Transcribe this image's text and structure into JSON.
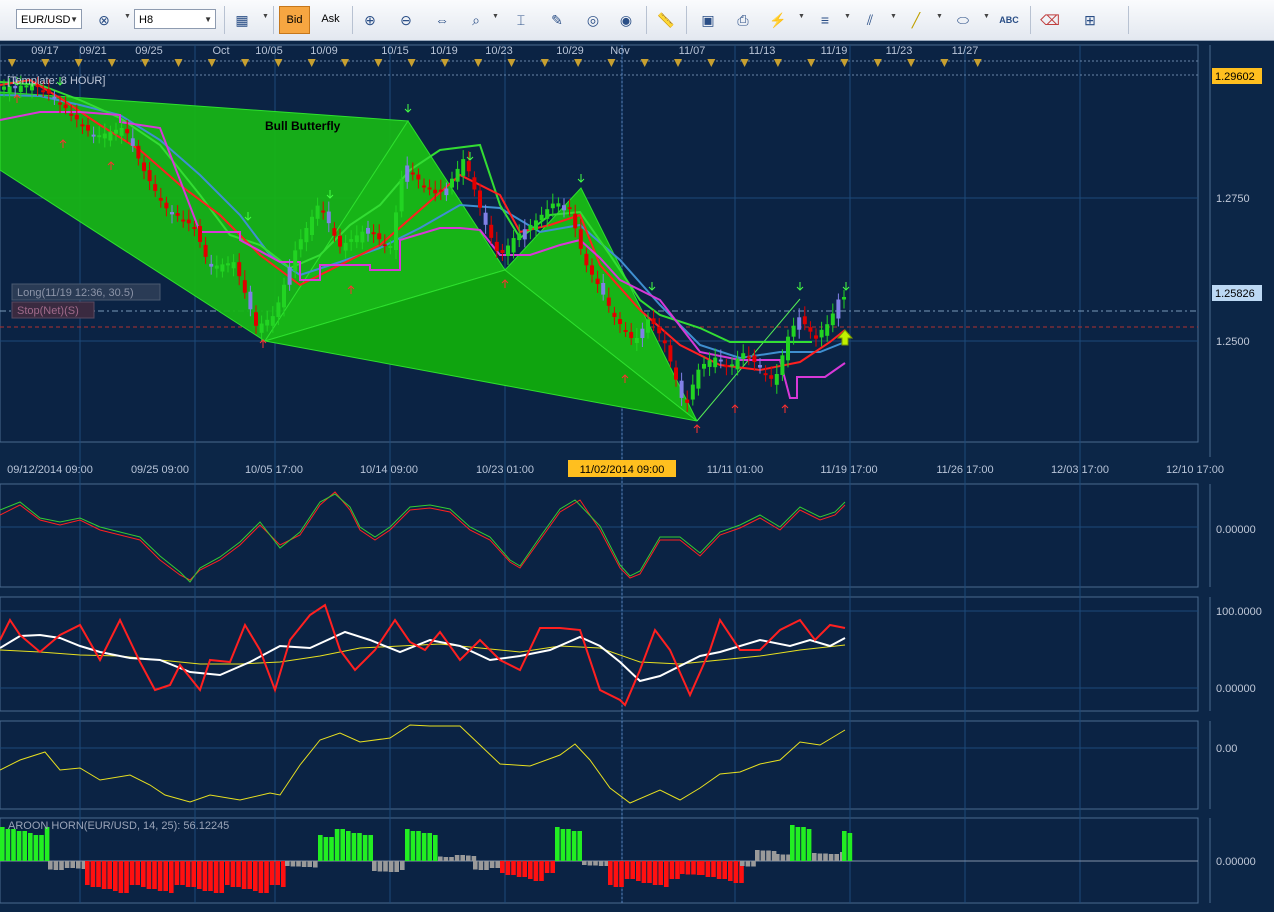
{
  "toolbar": {
    "symbol": "EUR/USD",
    "timeframe": "H8",
    "bid_label": "Bid",
    "ask_label": "Ask",
    "icons": [
      "symbol-cancel-icon",
      "chart-type-icon",
      "zoom-in-icon",
      "zoom-out-icon",
      "scroll-icon",
      "magnify-icon",
      "crosshair-icon",
      "edit-chart-icon",
      "hide-icon",
      "globe-icon",
      "ruler-icon",
      "screenshot-icon",
      "print-icon",
      "studies-icon",
      "indicators-icon",
      "trendline-icon",
      "line-tool-icon",
      "ellipse-icon",
      "text-tool-icon",
      "eraser-icon",
      "layout-icon"
    ]
  },
  "top_dates": [
    "09/17",
    "09/21",
    "09/25",
    "Oct",
    "10/05",
    "10/09",
    "10/15",
    "10/19",
    "10/23",
    "10/29",
    "Nov",
    "11/07",
    "11/13",
    "11/19",
    "11/23",
    "11/27"
  ],
  "bottom_dates": [
    "09/12/2014 09:00",
    "09/25 09:00",
    "10/05 17:00",
    "10/14 09:00",
    "10/23 01:00",
    "11/02/2014 09:00",
    "11/11 01:00",
    "11/19 17:00",
    "11/26 17:00",
    "12/03 17:00",
    "12/10 17:00"
  ],
  "main_panel": {
    "template_label": "[Template: 8 HOUR]",
    "pattern_label": "Bull Butterfly",
    "position_long": "Long(11/19 12:36, 30.5)",
    "position_stop": "Stop(Net)(S)",
    "price_top": "1.29602",
    "price_current": "1.25826",
    "y_ticks": [
      "1.2750",
      "1.2500"
    ],
    "colors": {
      "pattern": "#17b417",
      "bull": "#22d422",
      "bear": "#e00000",
      "neutral": "#8080e6",
      "ma_green": "#33dd33",
      "ma_red": "#ff2020",
      "ma_blue": "#3f8fd0",
      "ma_magenta": "#d838d8",
      "highlight": "#ffbf1f"
    }
  },
  "panel2": {
    "tick": "0.00000"
  },
  "panel3": {
    "ticks": [
      "100.0000",
      "0.00000"
    ]
  },
  "panel4": {
    "tick": "0.00"
  },
  "panel5": {
    "label": "AROON HORN(EUR/USD, 14, 25): 56.12245",
    "tick": "0.00000"
  }
}
